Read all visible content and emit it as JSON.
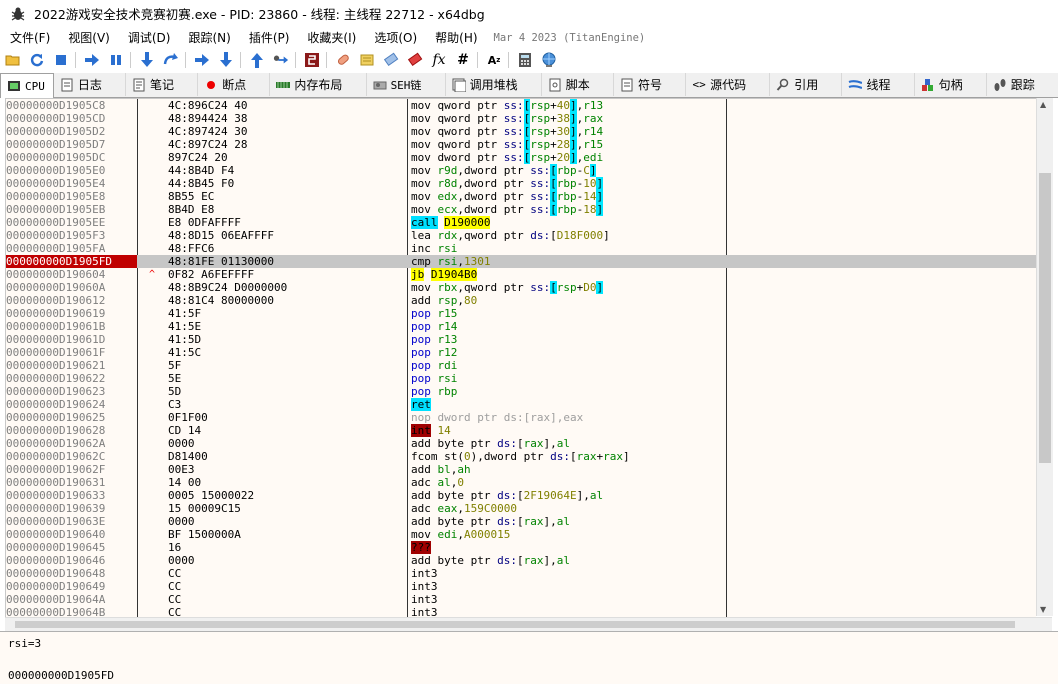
{
  "window": {
    "title": "2022游戏安全技术竞赛初赛.exe - PID: 23860 - 线程: 主线程 22712 - x64dbg"
  },
  "menu": {
    "items": [
      "文件(F)",
      "视图(V)",
      "调试(D)",
      "跟踪(N)",
      "插件(P)",
      "收藏夹(I)",
      "选项(O)",
      "帮助(H)"
    ],
    "build_date": "Mar 4 2023 (TitanEngine)"
  },
  "tabs": [
    "CPU",
    "日志",
    "笔记",
    "断点",
    "内存布局",
    "SEH链",
    "调用堆栈",
    "脚本",
    "符号",
    "源代码",
    "引用",
    "线程",
    "句柄",
    "跟踪"
  ],
  "disasm": {
    "rows": [
      {
        "addr": "00000000D1905C8",
        "bytes": "4C:896C24 40",
        "m": "mov",
        "ops": "qword ptr ss:[rsp+40],r13"
      },
      {
        "addr": "00000000D1905CD",
        "bytes": "48:894424 38",
        "m": "mov",
        "ops": "qword ptr ss:[rsp+38],rax"
      },
      {
        "addr": "00000000D1905D2",
        "bytes": "4C:897424 30",
        "m": "mov",
        "ops": "qword ptr ss:[rsp+30],r14"
      },
      {
        "addr": "00000000D1905D7",
        "bytes": "4C:897C24 28",
        "m": "mov",
        "ops": "qword ptr ss:[rsp+28],r15"
      },
      {
        "addr": "00000000D1905DC",
        "bytes": "897C24 20",
        "m": "mov",
        "ops": "dword ptr ss:[rsp+20],edi"
      },
      {
        "addr": "00000000D1905E0",
        "bytes": "44:8B4D F4",
        "m": "mov",
        "ops": "r9d,dword ptr ss:[rbp-C]"
      },
      {
        "addr": "00000000D1905E4",
        "bytes": "44:8B45 F0",
        "m": "mov",
        "ops": "r8d,dword ptr ss:[rbp-10]"
      },
      {
        "addr": "00000000D1905E8",
        "bytes": "8B55 EC",
        "m": "mov",
        "ops": "edx,dword ptr ss:[rbp-14]"
      },
      {
        "addr": "00000000D1905EB",
        "bytes": "8B4D E8",
        "m": "mov",
        "ops": "ecx,dword ptr ss:[rbp-18]"
      },
      {
        "addr": "00000000D1905EE",
        "bytes": "E8 0DFAFFFF",
        "m": "call",
        "ops": "D190000"
      },
      {
        "addr": "00000000D1905F3",
        "bytes": "48:8D15 06EAFFFF",
        "m": "lea",
        "ops": "rdx,qword ptr ds:[D18F000]"
      },
      {
        "addr": "00000000D1905FA",
        "bytes": "48:FFC6",
        "m": "inc",
        "ops": "rsi"
      },
      {
        "addr": "000000000D1905FD",
        "bytes": "48:81FE 01130000",
        "m": "cmp",
        "ops": "rsi,1301"
      },
      {
        "addr": "00000000D190604",
        "bytes": "0F82 A6FEFFFF",
        "m": "jb",
        "ops": "D1904B0"
      },
      {
        "addr": "00000000D19060A",
        "bytes": "48:8B9C24 D0000000",
        "m": "mov",
        "ops": "rbx,qword ptr ss:[rsp+D0]"
      },
      {
        "addr": "00000000D190612",
        "bytes": "48:81C4 80000000",
        "m": "add",
        "ops": "rsp,80"
      },
      {
        "addr": "00000000D190619",
        "bytes": "41:5F",
        "m": "pop",
        "ops": "r15"
      },
      {
        "addr": "00000000D19061B",
        "bytes": "41:5E",
        "m": "pop",
        "ops": "r14"
      },
      {
        "addr": "00000000D19061D",
        "bytes": "41:5D",
        "m": "pop",
        "ops": "r13"
      },
      {
        "addr": "00000000D19061F",
        "bytes": "41:5C",
        "m": "pop",
        "ops": "r12"
      },
      {
        "addr": "00000000D190621",
        "bytes": "5F",
        "m": "pop",
        "ops": "rdi"
      },
      {
        "addr": "00000000D190622",
        "bytes": "5E",
        "m": "pop",
        "ops": "rsi"
      },
      {
        "addr": "00000000D190623",
        "bytes": "5D",
        "m": "pop",
        "ops": "rbp"
      },
      {
        "addr": "00000000D190624",
        "bytes": "C3",
        "m": "ret",
        "ops": ""
      },
      {
        "addr": "00000000D190625",
        "bytes": "0F1F00",
        "m": "nop",
        "ops": "dword ptr ds:[rax],eax"
      },
      {
        "addr": "00000000D190628",
        "bytes": "CD 14",
        "m": "int",
        "ops": "14"
      },
      {
        "addr": "00000000D19062A",
        "bytes": "0000",
        "m": "add",
        "ops": "byte ptr ds:[rax],al"
      },
      {
        "addr": "00000000D19062C",
        "bytes": "D81400",
        "m": "fcom",
        "ops": "st(0),dword ptr ds:[rax+rax]"
      },
      {
        "addr": "00000000D19062F",
        "bytes": "00E3",
        "m": "add",
        "ops": "bl,ah"
      },
      {
        "addr": "00000000D190631",
        "bytes": "14 00",
        "m": "adc",
        "ops": "al,0"
      },
      {
        "addr": "00000000D190633",
        "bytes": "0005 15000022",
        "m": "add",
        "ops": "byte ptr ds:[2F19064E],al"
      },
      {
        "addr": "00000000D190639",
        "bytes": "15 00009C15",
        "m": "adc",
        "ops": "eax,159C0000"
      },
      {
        "addr": "00000000D19063E",
        "bytes": "0000",
        "m": "add",
        "ops": "byte ptr ds:[rax],al"
      },
      {
        "addr": "00000000D190640",
        "bytes": "BF 1500000A",
        "m": "mov",
        "ops": "edi,A000015"
      },
      {
        "addr": "00000000D190645",
        "bytes": "16",
        "m": "???",
        "ops": ""
      },
      {
        "addr": "00000000D190646",
        "bytes": "0000",
        "m": "add",
        "ops": "byte ptr ds:[rax],al"
      },
      {
        "addr": "00000000D190648",
        "bytes": "CC",
        "m": "int3",
        "ops": ""
      },
      {
        "addr": "00000000D190649",
        "bytes": "CC",
        "m": "int3",
        "ops": ""
      },
      {
        "addr": "00000000D19064A",
        "bytes": "CC",
        "m": "int3",
        "ops": ""
      },
      {
        "addr": "00000000D19064B",
        "bytes": "CC",
        "m": "int3",
        "ops": ""
      }
    ],
    "current_row_index": 12,
    "branch_marker": "^",
    "branch_marker_row_index": 13
  },
  "info": {
    "line1": "rsi=3",
    "line2": "000000000D1905FD"
  },
  "colors": {
    "current_address_bg": "#c00000",
    "current_row_bg": "#c6c6c6",
    "call_bg": "#00e0ff",
    "jump_bg": "#ffff00",
    "int_bg": "#a00000",
    "panel_bg": "#fffaf5"
  },
  "icons": {
    "toolbar": [
      "open-icon",
      "restart-icon",
      "stop-icon",
      "run-icon",
      "pause-icon",
      "step-into-icon",
      "step-over-icon",
      "trace-into-icon",
      "trace-over-icon",
      "execute-till-return-icon",
      "run-to-user-code-icon",
      "scylla-icon",
      "patch-icon",
      "comment-icon",
      "label-icon",
      "bookmark-icon",
      "function-icon",
      "hash-icon",
      "font-icon",
      "calculator-icon",
      "globe-icon"
    ]
  }
}
